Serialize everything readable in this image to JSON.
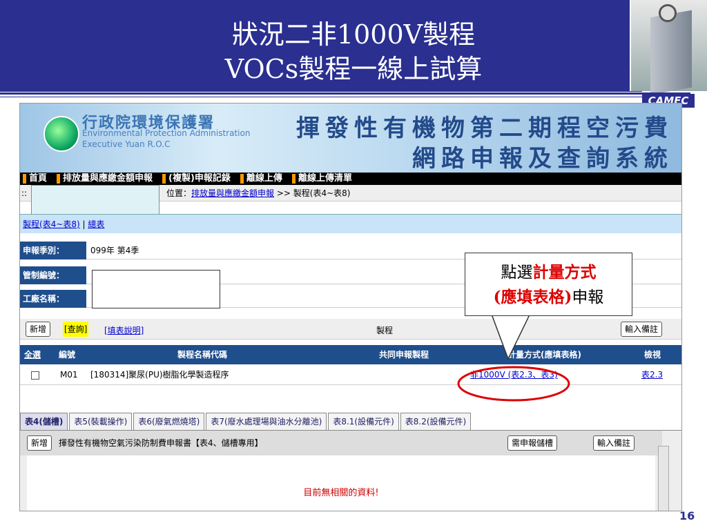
{
  "slide": {
    "title_line1": "狀況二非1000V製程",
    "title_line2": "VOCs製程一線上試算",
    "brand": "CAMEC",
    "page": "16"
  },
  "banner": {
    "org_zh": "行政院環境保護署",
    "org_en1": "Environmental Protection Administration",
    "org_en2": "Executive Yuan R.O.C",
    "sys_line1": "揮發性有機物第二期程空污費",
    "sys_line2": "網路申報及查詢系統"
  },
  "nav": {
    "items": [
      "首頁",
      "排放量與應繳金額申報",
      "(複製)申報記錄",
      "離線上傳",
      "離線上傳清單"
    ]
  },
  "location": {
    "dots": "::",
    "prefix": "位置：",
    "link": "排放量與應繳金額申報",
    "suffix": " >> 製程(表4~表8)"
  },
  "subnav": {
    "link1": "製程(表4~表8)",
    "sep": " | ",
    "link2": "總表"
  },
  "form": {
    "season_label": "申報季別：",
    "season_value": "099年 第4季",
    "control_label": "管制編號：",
    "factory_label": "工廠名稱："
  },
  "toolbar": {
    "add": "新增",
    "query": "[查詢]",
    "help": "[填表說明]",
    "section": "製程",
    "note": "輸入備註"
  },
  "table": {
    "headers": [
      "全選",
      "編號",
      "製程名稱代碼",
      "共同申報製程",
      "計量方式(應填表格)",
      "檢視"
    ],
    "rows": [
      {
        "id": "M01",
        "name": "[180314]聚尿(PU)樹脂化學製造程序",
        "shared": "",
        "method": "非1000V (表2.3、表3)",
        "view": "表2.3"
      }
    ]
  },
  "tabs": [
    "表4(儲槽)",
    "表5(裝載操作)",
    "表6(廢氣燃燒塔)",
    "表7(廢水處理場與油水分離池)",
    "表8.1(設備元件)",
    "表8.2(設備元件)"
  ],
  "panel": {
    "add": "新增",
    "title": "揮發性有機物空氣污染防制費申報書【表4、儲槽專用】",
    "need": "需申報儲槽",
    "note": "輸入備註",
    "empty": "目前無相關的資料!"
  },
  "callout": {
    "a": "點選",
    "b": "計量方式",
    "c": "(應填表格)",
    "d": "申報"
  },
  "colors": {
    "slide_blue": "#2a2f90",
    "header_blue": "#1f4e8c",
    "highlight": "#d00"
  }
}
